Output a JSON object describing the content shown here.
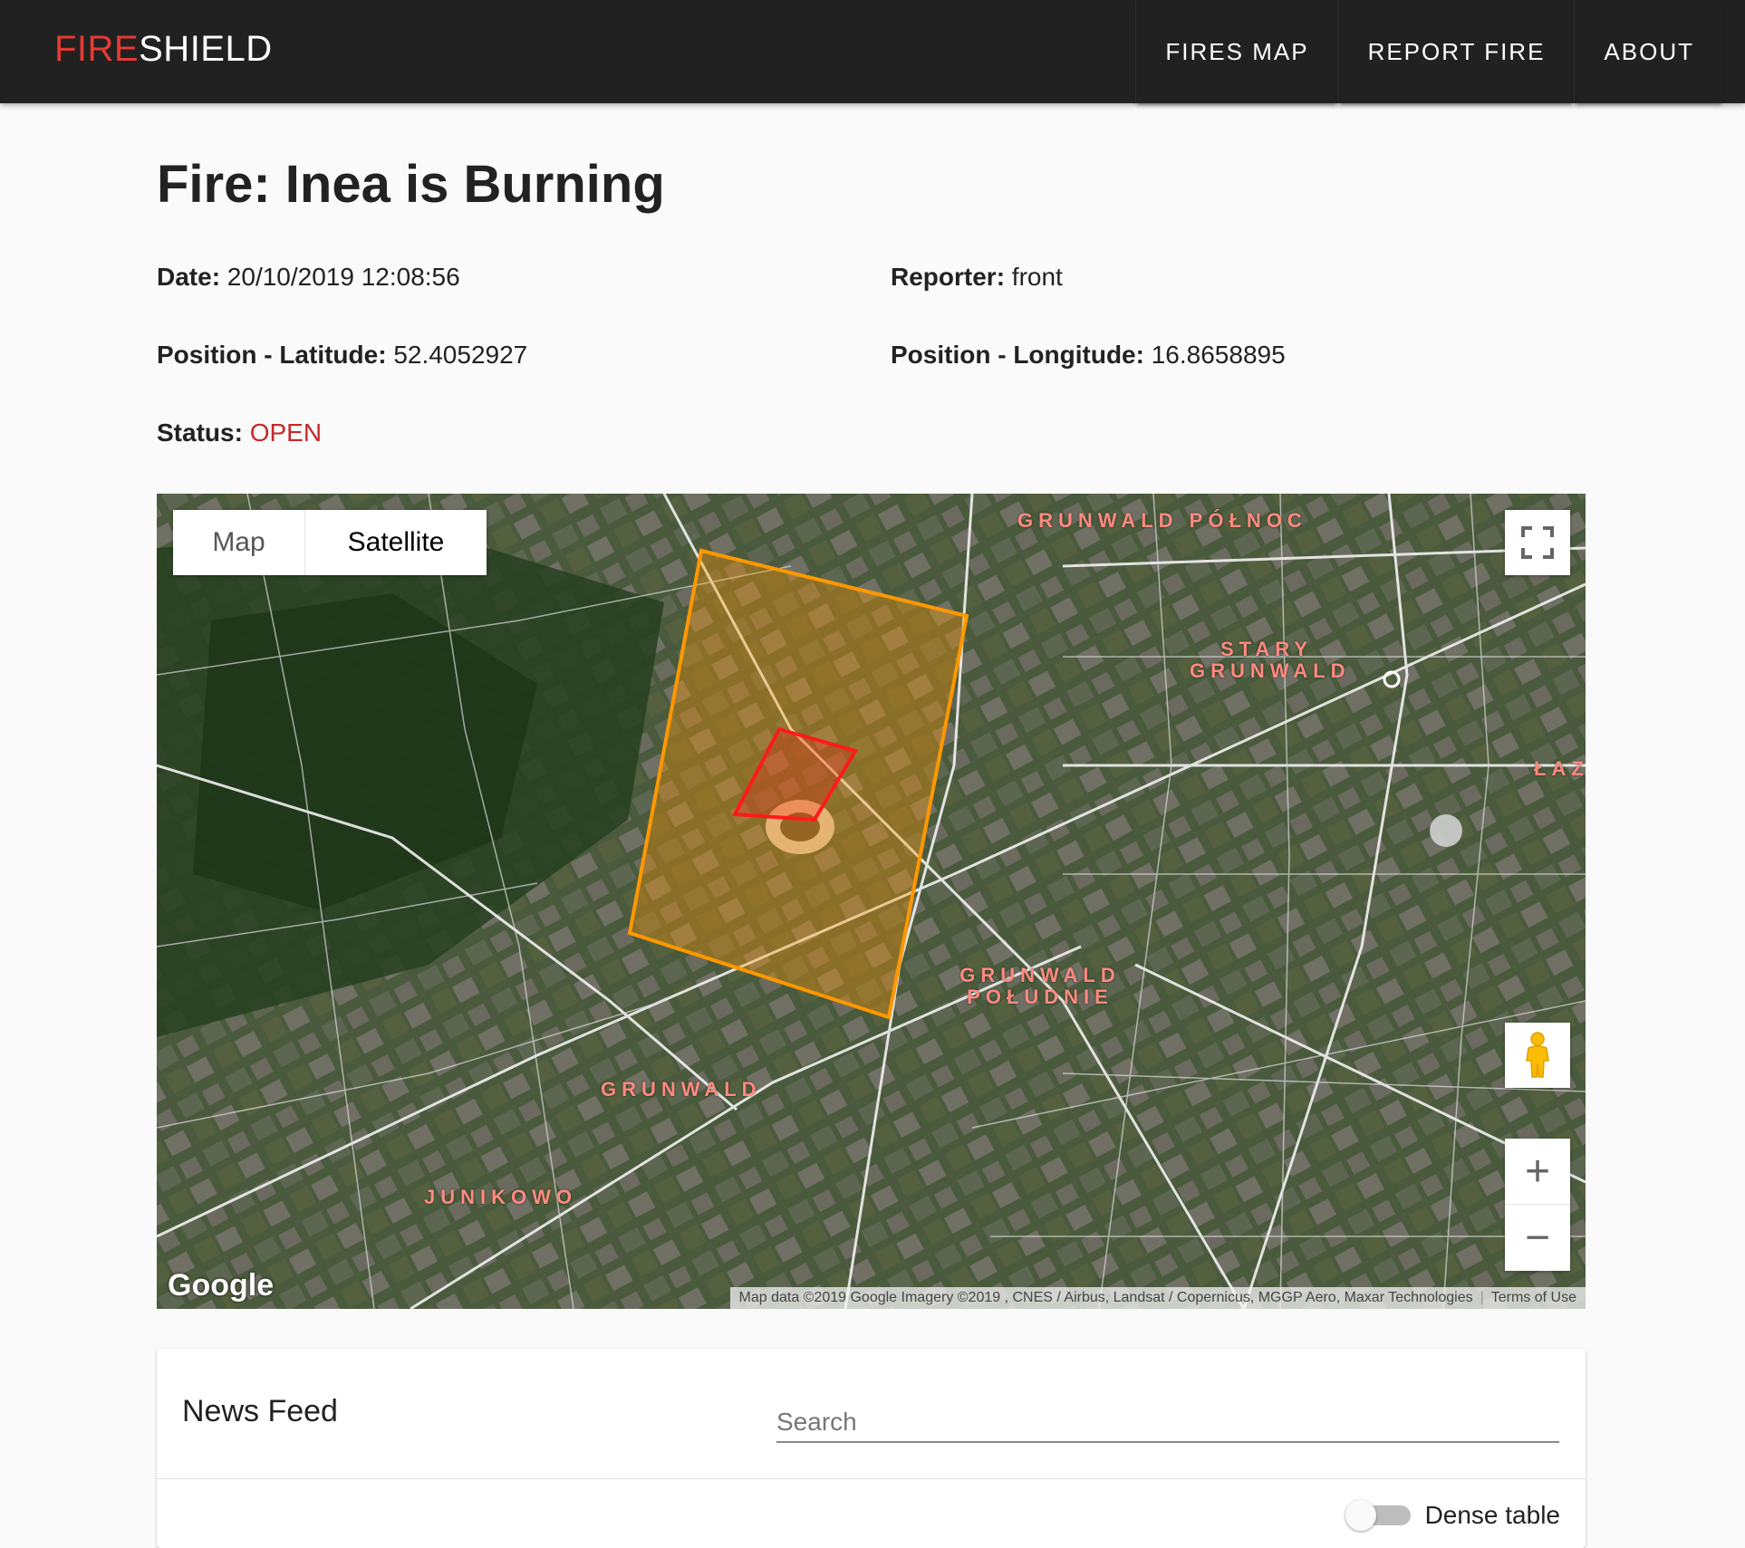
{
  "brand": {
    "part1": "FIRE",
    "part2": "SHIELD"
  },
  "nav": {
    "items": [
      {
        "label": "FIRES MAP"
      },
      {
        "label": "REPORT FIRE"
      },
      {
        "label": "ABOUT"
      }
    ]
  },
  "fire": {
    "title": "Fire: Inea is Burning",
    "date_label": "Date:",
    "date_value": "20/10/2019 12:08:56",
    "reporter_label": "Reporter:",
    "reporter_value": "front",
    "lat_label": "Position - Latitude:",
    "lat_value": "52.4052927",
    "lng_label": "Position - Longitude:",
    "lng_value": "16.8658895",
    "status_label": "Status:",
    "status_value": "OPEN"
  },
  "map": {
    "type_map": "Map",
    "type_satellite": "Satellite",
    "selected_type": "Satellite",
    "districts": {
      "grunwald_polnoc": "GRUNWALD PÓŁNOC",
      "stary_grunwald": "STARY GRUNWALD",
      "lazarz": "ŁAZ",
      "grunwald_poludnie": "GRUNWALD POŁUDNIE",
      "grunwald": "GRUNWALD",
      "junikowo": "JUNIKOWO"
    },
    "logo": "Google",
    "attribution": "Map data ©2019 Google Imagery ©2019 , CNES / Airbus, Landsat / Copernicus, MGGP Aero, Maxar Technologies",
    "terms": "Terms of Use",
    "controls": {
      "fullscreen_icon": "fullscreen-icon",
      "pegman_icon": "pegman-icon",
      "zoom_in": "+",
      "zoom_out": "−"
    },
    "colors": {
      "outer_zone": "#ff9800",
      "inner_zone": "#ff1a1a"
    }
  },
  "news_feed": {
    "title": "News Feed",
    "search_placeholder": "Search",
    "search_value": "",
    "dense_label": "Dense table",
    "dense_on": false
  }
}
